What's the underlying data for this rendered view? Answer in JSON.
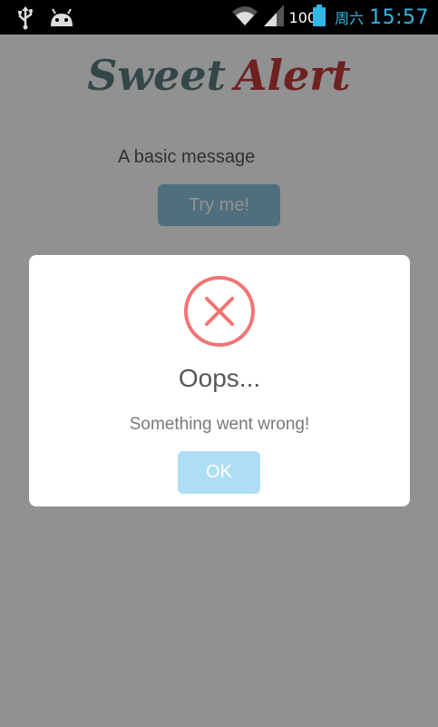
{
  "status_bar": {
    "battery_text": "100",
    "day": "周六",
    "time": "15:57",
    "icons": [
      "usb-icon",
      "android-debug-icon",
      "wifi-icon",
      "signal-icon",
      "battery-icon"
    ]
  },
  "app": {
    "title_word1": "Sweet",
    "title_word2": "Alert",
    "basic_message": "A basic message",
    "try_button_label": "Try me!"
  },
  "dialog": {
    "title": "Oops...",
    "message": "Something went wrong!",
    "ok_label": "OK",
    "icon": "error-x-icon"
  },
  "colors": {
    "status_accent": "#33b5e5",
    "error_red": "#f27474",
    "ok_button": "#aedef4",
    "try_button": "#8cc4de"
  }
}
